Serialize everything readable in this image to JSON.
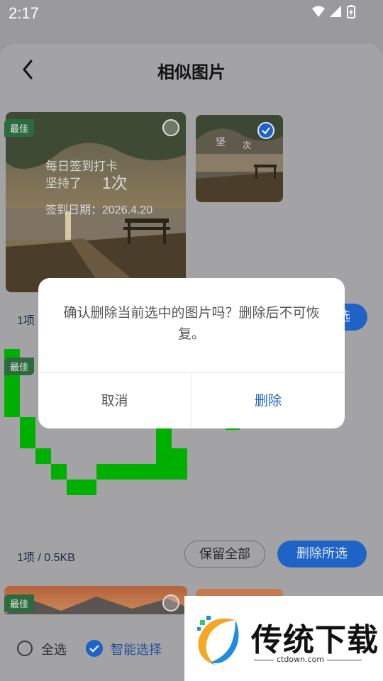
{
  "status_bar": {
    "time": "2:17"
  },
  "header": {
    "title": "相似图片"
  },
  "group1": {
    "best_tag": "最佳",
    "overlay_line1": "每日签到打卡",
    "overlay_line2": "坚持了",
    "overlay_count": "1次",
    "overlay_date": "签到日期：2026.4.20",
    "small_overlay_1": "坚",
    "small_overlay_2": "次",
    "info": "1项",
    "delete_partial": "选"
  },
  "group2": {
    "best_tag": "最佳",
    "info": "1项 / 0.5KB",
    "keep_all": "保留全部",
    "delete_selected": "删除所选"
  },
  "group3": {
    "best_tag": "最佳"
  },
  "bottom_bar": {
    "select_all": "全选",
    "smart_select": "智能选择"
  },
  "watermark": {
    "brand": "传统下载",
    "url": "ctdown.com"
  },
  "dialog": {
    "message": "确认删除当前选中的图片吗？删除后不可恢复。",
    "cancel": "取消",
    "confirm": "删除"
  },
  "colors": {
    "accent": "#1f63c6",
    "best_tag": "#2b6b3d",
    "glitch_green": "#00b000"
  }
}
